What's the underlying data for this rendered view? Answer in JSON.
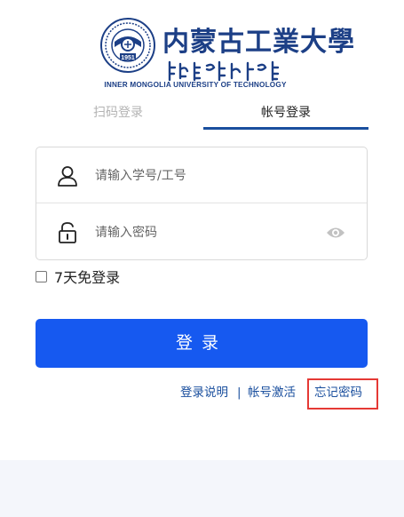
{
  "logo": {
    "name_cn": "内蒙古工業大學",
    "name_en": "INNER MONGOLIA UNIVERSITY OF TECHNOLOGY",
    "emblem_year": "1951"
  },
  "tabs": [
    {
      "label": "扫码登录",
      "active": false
    },
    {
      "label": "帐号登录",
      "active": true
    }
  ],
  "form": {
    "username_placeholder": "请输入学号/工号",
    "username_value": "",
    "password_placeholder": "请输入密码",
    "password_value": ""
  },
  "remember": {
    "label": "7天免登录",
    "checked": false
  },
  "login_button": "登录",
  "links": {
    "help": "登录说明",
    "separator": "|",
    "activate": "帐号激活",
    "forgot": "忘记密码"
  },
  "colors": {
    "primary": "#1659f0",
    "brand": "#1c3f86",
    "highlight_box": "#e53935"
  },
  "icons": [
    "user-icon",
    "lock-icon",
    "eye-icon"
  ]
}
